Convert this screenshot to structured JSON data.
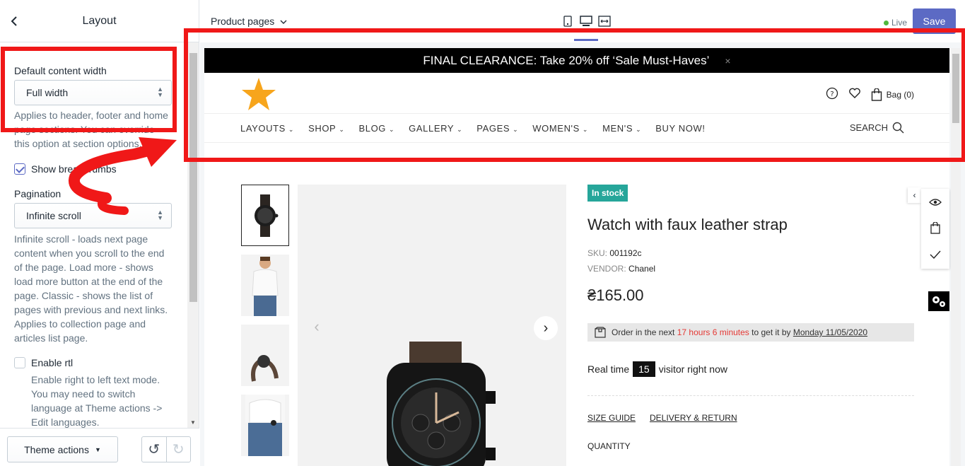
{
  "sidebar": {
    "title": "Layout",
    "content_width": {
      "label": "Default content width",
      "value": "Full width",
      "help_lines": [
        "Applies to header, footer and home",
        "page sections. You can override",
        "this option at section options."
      ]
    },
    "breadcrumbs": {
      "label": "Show breadcrumbs",
      "checked": true
    },
    "pagination": {
      "label": "Pagination",
      "value": "Infinite scroll",
      "help_lines": [
        "Infinite scroll - loads next page",
        "content when you scroll to the end",
        "of the page. Load more - shows",
        "load more button at the end of the",
        "page. Classic - shows the list of",
        "pages with previous and next links.",
        "Applies to collection page and",
        "articles list page."
      ]
    },
    "rtl": {
      "label": "Enable rtl",
      "checked": false,
      "help_lines": [
        "Enable right to left text mode.",
        "You may need to switch",
        "language at Theme actions ->",
        "Edit languages."
      ]
    },
    "footer": {
      "theme_actions": "Theme actions"
    }
  },
  "topbar": {
    "page_select": "Product pages",
    "live_label": "Live",
    "save_label": "Save",
    "accent": "#5c6ac4"
  },
  "store": {
    "announcement": "FINAL CLEARANCE: Take 20% off ‘Sale Must-Haves’",
    "announcement_close": "×",
    "bag_label": "Bag (0)",
    "nav": [
      "LAYOUTS",
      "SHOP",
      "BLOG",
      "GALLERY",
      "PAGES",
      "WOMEN'S",
      "MEN'S",
      "BUY NOW!"
    ],
    "search_label": "SEARCH",
    "product": {
      "badge": "In stock",
      "title": "Watch with faux leather strap",
      "sku_label": "SKU:",
      "sku": "001192c",
      "vendor_label": "VENDOR:",
      "vendor": "Chanel",
      "price": "₴165.00",
      "order_prefix": "Order in the next",
      "order_time": "17 hours 6 minutes",
      "order_mid": "to get it by",
      "order_date": "Monday 11/05/2020",
      "realtime_prefix": "Real time",
      "realtime_count": "15",
      "realtime_suffix": "visitor right now",
      "size_guide": "SIZE GUIDE",
      "delivery": "DELIVERY & RETURN",
      "quantity": "QUANTITY"
    }
  },
  "annotation_color": "#f01818"
}
